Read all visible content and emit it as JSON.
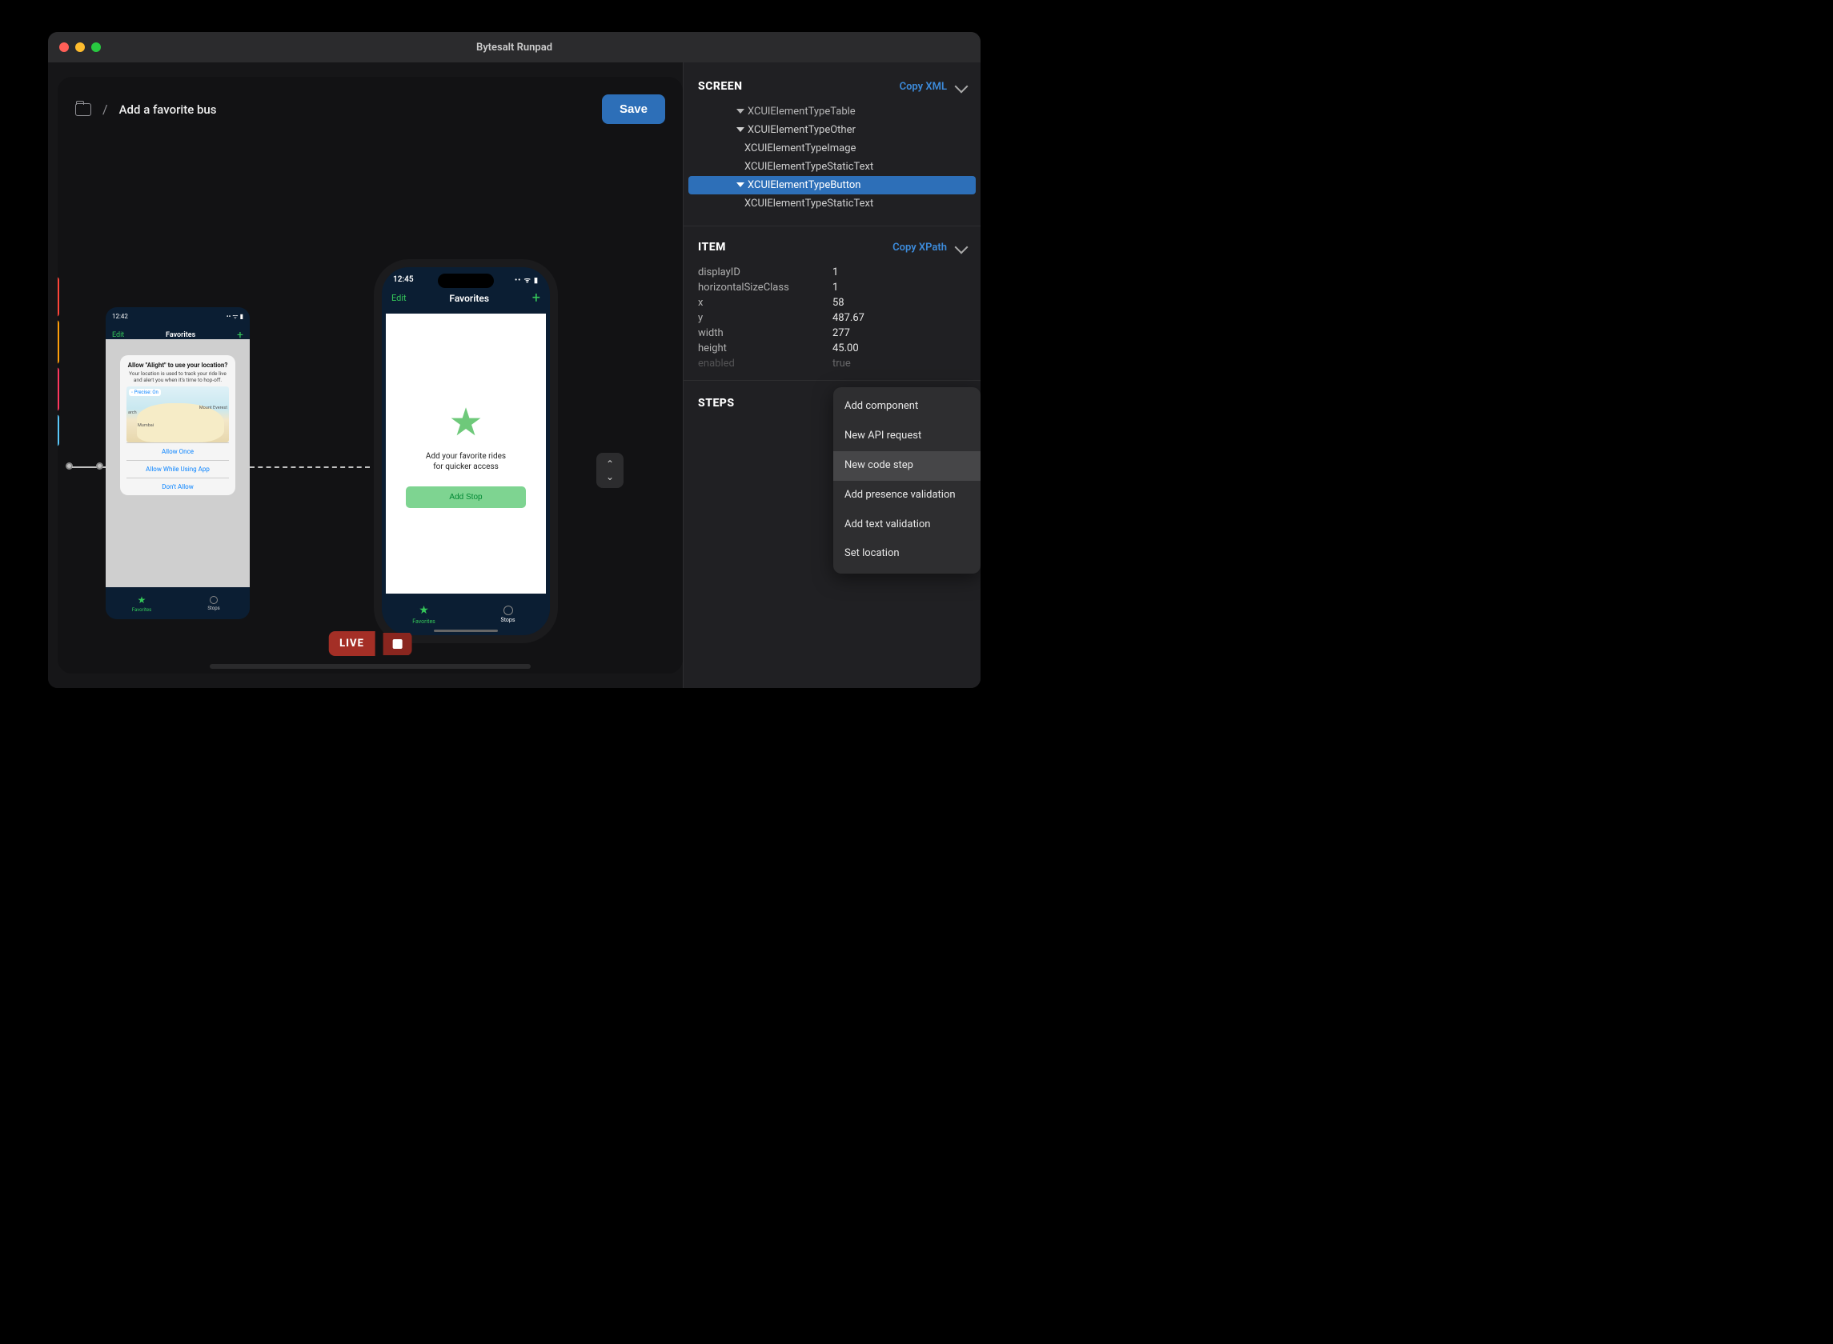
{
  "window": {
    "title": "Bytesalt Runpad"
  },
  "breadcrumb": {
    "title": "Add a favorite bus"
  },
  "actions": {
    "save": "Save"
  },
  "live": {
    "label": "LIVE"
  },
  "phone1": {
    "time": "12:42",
    "nav": {
      "edit": "Edit",
      "title": "Favorites",
      "plus": "+"
    },
    "alert": {
      "title": "Allow \"Alight\" to use your location?",
      "body": "Your location is used to track your ride live and alert you when it's time to hop-off.",
      "precise": "◦ Precise: On",
      "map_labels": {
        "arch": "arch",
        "mumbai": "Mumbai",
        "everest": "Mount Everest"
      },
      "allow_once": "Allow Once",
      "allow_while": "Allow While Using App",
      "dont_allow": "Don't Allow"
    },
    "tabs": {
      "favorites": "Favorites",
      "stops": "Stops"
    }
  },
  "phone2": {
    "time": "12:45",
    "nav": {
      "edit": "Edit",
      "title": "Favorites",
      "plus": "+"
    },
    "content": {
      "line1": "Add your favorite rides",
      "line2": "for quicker access",
      "add_stop": "Add Stop"
    },
    "tabs": {
      "favorites": "Favorites",
      "stops": "Stops"
    }
  },
  "inspector": {
    "screen": {
      "title": "SCREEN",
      "copy": "Copy XML",
      "tree": [
        {
          "label": "XCUIElementTypeTable",
          "indent": 2,
          "expanded": false,
          "selected": false,
          "cut": true
        },
        {
          "label": "XCUIElementTypeOther",
          "indent": 2,
          "expanded": true,
          "selected": false
        },
        {
          "label": "XCUIElementTypeImage",
          "indent": 3,
          "selected": false
        },
        {
          "label": "XCUIElementTypeStaticText",
          "indent": 3,
          "selected": false
        },
        {
          "label": "XCUIElementTypeButton",
          "indent": 2,
          "expanded": true,
          "selected": true
        },
        {
          "label": "XCUIElementTypeStaticText",
          "indent": 3,
          "selected": false
        }
      ]
    },
    "item": {
      "title": "ITEM",
      "copy": "Copy XPath",
      "rows": [
        {
          "key": "displayID",
          "val": "1"
        },
        {
          "key": "horizontalSizeClass",
          "val": "1"
        },
        {
          "key": "x",
          "val": "58"
        },
        {
          "key": "y",
          "val": "487.67"
        },
        {
          "key": "width",
          "val": "277"
        },
        {
          "key": "height",
          "val": "45.00"
        },
        {
          "key": "enabled",
          "val": "true"
        }
      ]
    },
    "steps": {
      "title": "STEPS",
      "menu": [
        {
          "label": "Add component",
          "hover": false
        },
        {
          "label": "New API request",
          "hover": false
        },
        {
          "label": "New code step",
          "hover": true
        },
        {
          "label": "Add presence validation",
          "hover": false
        },
        {
          "label": "Add text validation",
          "hover": false
        },
        {
          "label": "Set location",
          "hover": false
        }
      ]
    }
  }
}
